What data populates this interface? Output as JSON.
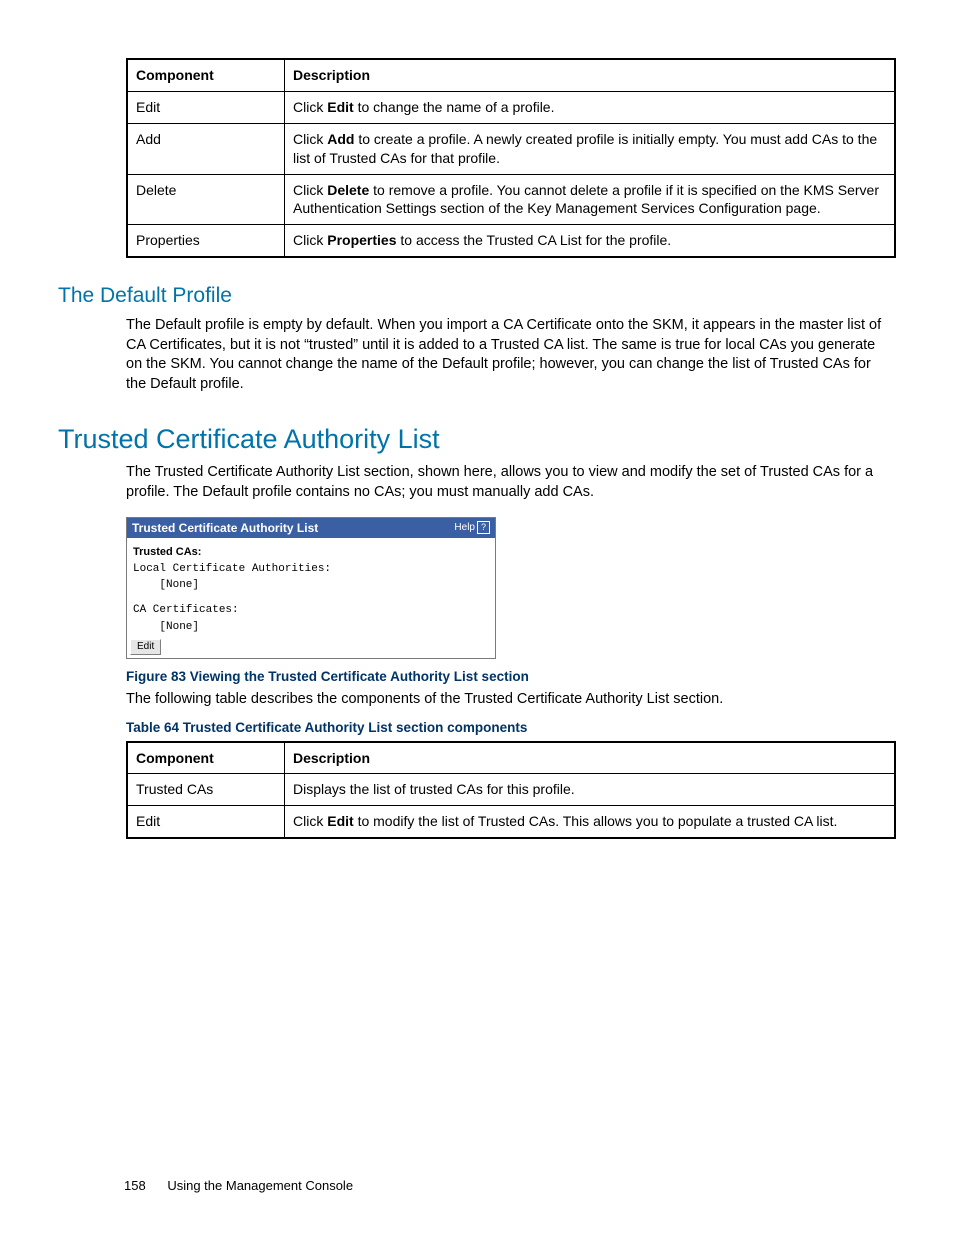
{
  "table1": {
    "headers": [
      "Component",
      "Description"
    ],
    "rows": [
      {
        "comp": "Edit",
        "desc_pre": "Click ",
        "desc_bold": "Edit",
        "desc_post": " to change the name of a profile."
      },
      {
        "comp": "Add",
        "desc_pre": "Click ",
        "desc_bold": "Add",
        "desc_post": " to create a profile. A newly created profile is initially empty. You must add CAs to the list of Trusted CAs for that profile."
      },
      {
        "comp": "Delete",
        "desc_pre": "Click ",
        "desc_bold": "Delete",
        "desc_post": " to remove a profile. You cannot delete a profile if it is specified on the KMS Server Authentication Settings section of the Key Management Services Configuration page."
      },
      {
        "comp": "Properties",
        "desc_pre": "Click ",
        "desc_bold": "Properties",
        "desc_post": " to access the Trusted CA List for the profile."
      }
    ]
  },
  "sec1": {
    "heading": "The Default Profile",
    "body": "The Default profile is empty by default. When you import a CA Certificate onto the SKM, it appears in the master list of CA Certificates, but it is not “trusted” until it is added to a Trusted CA list. The same is true for local CAs you generate on the SKM. You cannot change the name of the Default profile; however, you can change the list of Trusted CAs for the Default profile."
  },
  "sec2": {
    "heading": "Trusted Certificate Authority List",
    "intro": "The Trusted Certificate Authority List section, shown here, allows you to view and modify the set of Trusted CAs for a profile. The Default profile contains no CAs; you must manually add CAs."
  },
  "widget": {
    "title": "Trusted Certificate Authority List",
    "help": "Help",
    "label": "Trusted CAs:",
    "group1": "Local Certificate Authorities:",
    "none1": "    [None]",
    "group2": "CA Certificates:",
    "none2": "    [None]",
    "edit": "Edit"
  },
  "fig": "Figure 83 Viewing the Trusted Certificate Authority List section",
  "after_fig": "The following table describes the components of the Trusted Certificate Authority List section.",
  "table2_caption": "Table 64 Trusted Certificate Authority List section components",
  "table2": {
    "headers": [
      "Component",
      "Description"
    ],
    "rows": [
      {
        "comp": "Trusted CAs",
        "desc_pre": "",
        "desc_bold": "",
        "desc_post": "Displays the list of trusted CAs for this profile."
      },
      {
        "comp": "Edit",
        "desc_pre": "Click ",
        "desc_bold": "Edit",
        "desc_post": " to modify the list of Trusted CAs. This allows you to populate a trusted CA list."
      }
    ]
  },
  "footer": {
    "page": "158",
    "title": "Using the Management Console"
  }
}
